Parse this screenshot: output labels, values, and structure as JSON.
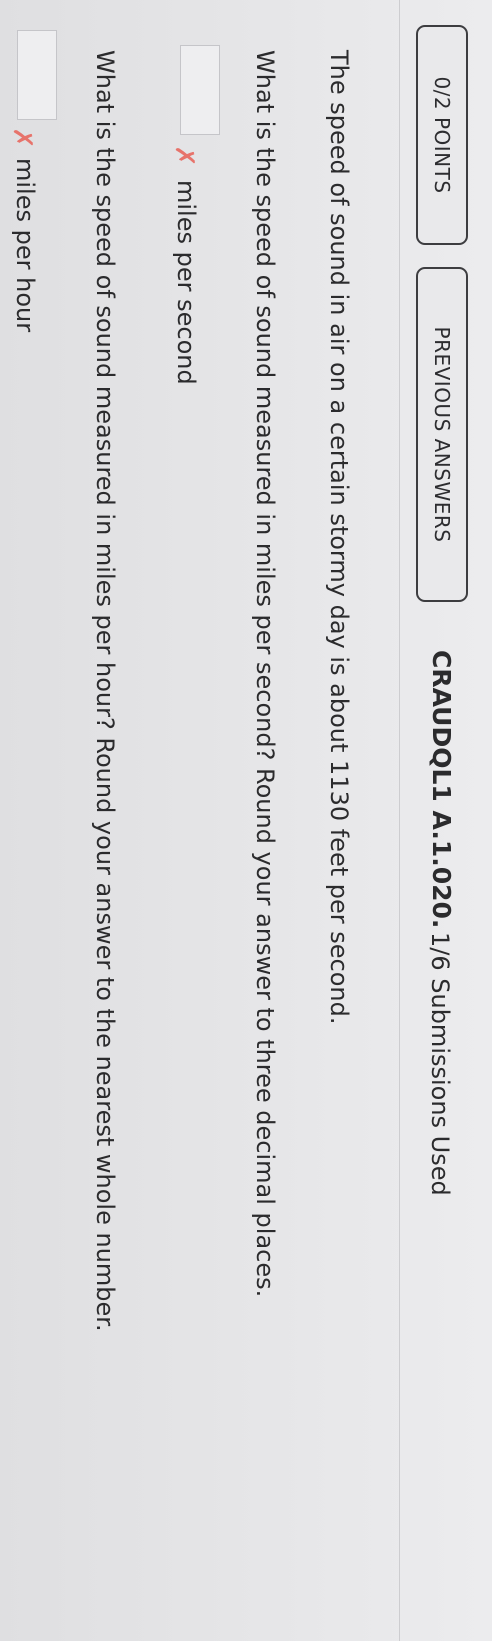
{
  "header": {
    "points_label": "0/2 POINTS",
    "previous_answers_label": "PREVIOUS ANSWERS",
    "question_id": "CRAUDQL1 A.1.020.",
    "submissions": "1/6 Submissions Used"
  },
  "problem": {
    "intro": "The speed of sound in air on a certain stormy day is about 1130 feet per second.",
    "parts": [
      {
        "question": "What is the speed of sound measured in miles per second? Round your answer to three decimal places.",
        "answer_value": "",
        "status_icon": "incorrect-x-icon",
        "unit": "miles per second"
      },
      {
        "question": "What is the speed of sound measured in miles per hour? Round your answer to the nearest whole number.",
        "answer_value": "",
        "status_icon": "incorrect-x-icon",
        "unit": "miles per hour"
      }
    ]
  },
  "colors": {
    "incorrect": "#e7736b",
    "button_border": "#3d3d40"
  }
}
